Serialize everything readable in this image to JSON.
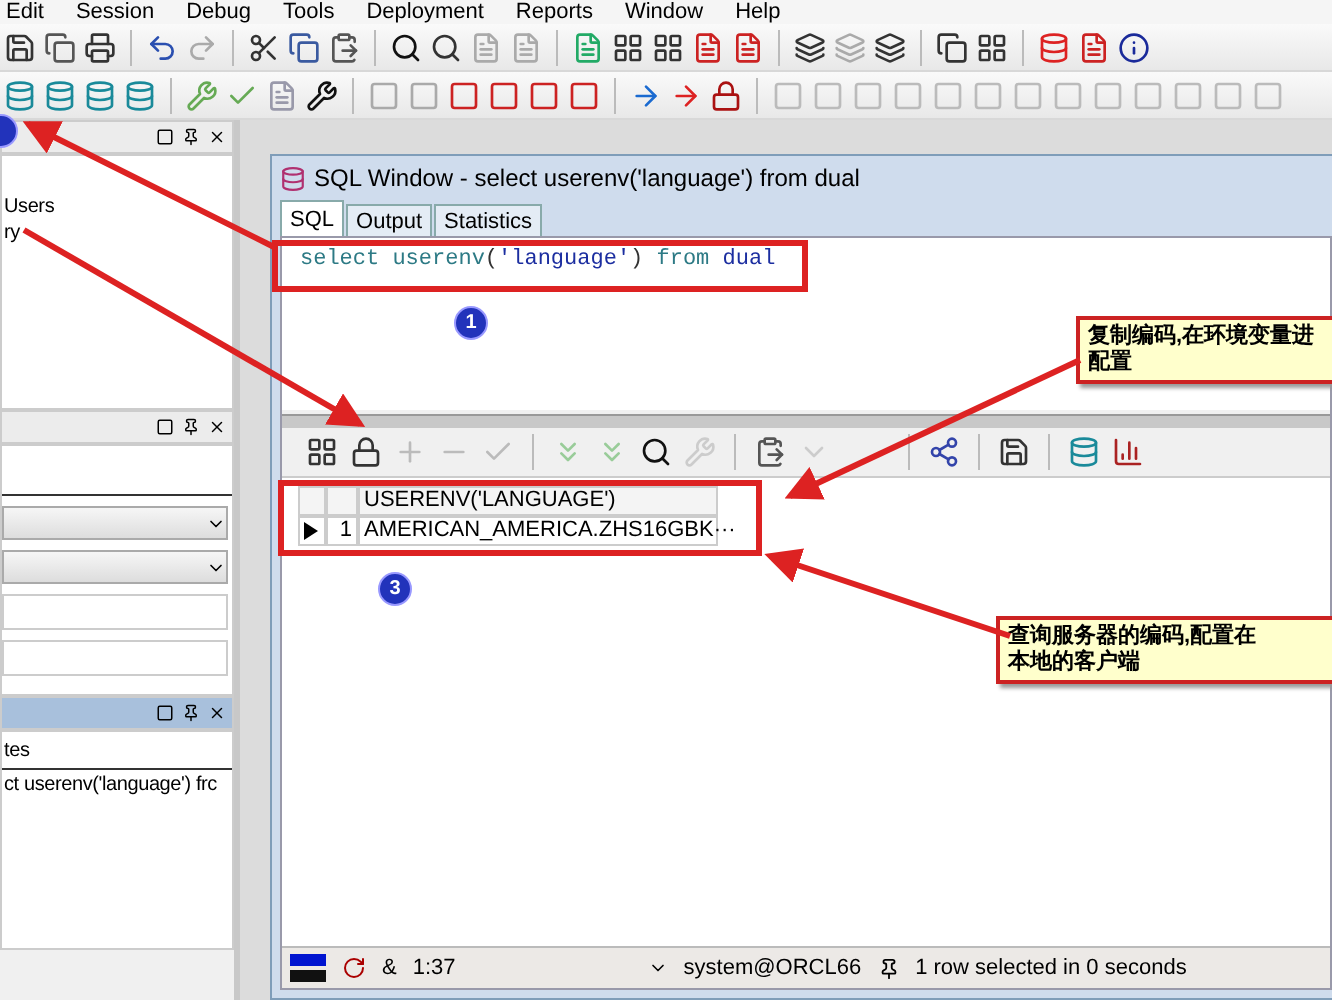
{
  "menu": [
    "Edit",
    "Session",
    "Debug",
    "Tools",
    "Deployment",
    "Reports",
    "Window",
    "Help"
  ],
  "left_panels": [
    {
      "active": false,
      "items": [
        "Users",
        "ry"
      ]
    },
    {
      "active": false
    },
    {
      "active": true,
      "tabs": [
        "tes"
      ],
      "items": [
        "ct userenv('language') frc"
      ]
    }
  ],
  "sql_window": {
    "title": "SQL Window - select userenv('language') from dual",
    "tabs": [
      {
        "label": "SQL",
        "selected": true
      },
      {
        "label": "Output",
        "selected": false
      },
      {
        "label": "Statistics",
        "selected": false
      }
    ],
    "editor": [
      {
        "kind": "keyword",
        "text": "select"
      },
      {
        "kind": "keyword",
        "text": " userenv"
      },
      {
        "kind": "plain",
        "text": "("
      },
      {
        "kind": "string",
        "text": "'language'"
      },
      {
        "kind": "plain",
        "text": ")"
      },
      {
        "kind": "keyword",
        "text": " from"
      },
      {
        "kind": "string",
        "text": " dual"
      }
    ],
    "grid": {
      "columns": [
        "USERENV('LANGUAGE')"
      ],
      "rows": [
        {
          "number": "1",
          "current": true,
          "cells": [
            "AMERICAN_AMERICA.ZHS16GBK"
          ],
          "cell_button": "···"
        }
      ]
    },
    "status_bar": {
      "symbol": "&",
      "position": "1:37",
      "connection": "system@ORCL66",
      "message": "1 row selected in 0 seconds"
    }
  },
  "annotations": {
    "badges": [
      "1",
      "3"
    ],
    "callouts": [
      {
        "lines": [
          "复制编码,在环境变量进",
          "配置"
        ]
      },
      {
        "lines": [
          "查询服务器的编码,配置在",
          "本地的客户端"
        ]
      }
    ]
  }
}
